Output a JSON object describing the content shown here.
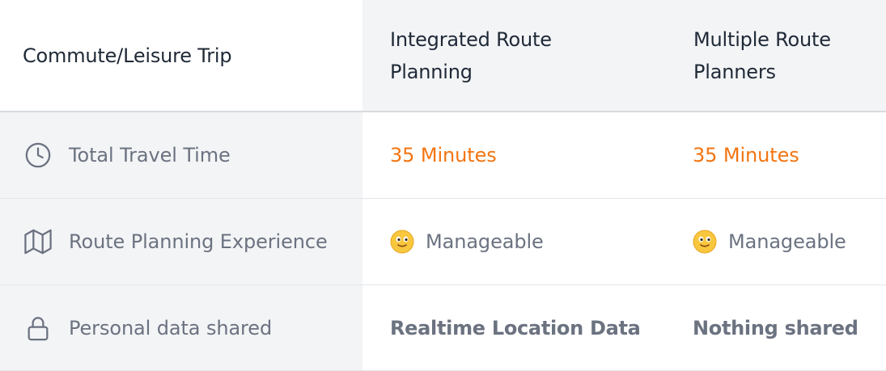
{
  "header": {
    "trip_label": "Commute/Leisure Trip",
    "columns": [
      "Integrated Route Planning",
      "Multiple Route Planners"
    ]
  },
  "rows": [
    {
      "icon": "clock-icon",
      "label": "Total Travel Time",
      "values": [
        "35 Minutes",
        "35 Minutes"
      ]
    },
    {
      "icon": "map-icon",
      "label": "Route Planning Experience",
      "value_icon": "slightly-smiling-face-emoji",
      "values": [
        "Manageable",
        "Manageable"
      ]
    },
    {
      "icon": "lock-icon",
      "label": "Personal data shared",
      "values": [
        "Realtime Location Data",
        "Nothing shared"
      ]
    }
  ],
  "colors": {
    "accent_orange": "#f27512",
    "muted_text": "#6b7280",
    "header_text": "#1f2937",
    "column_bg": "#f3f4f6"
  }
}
